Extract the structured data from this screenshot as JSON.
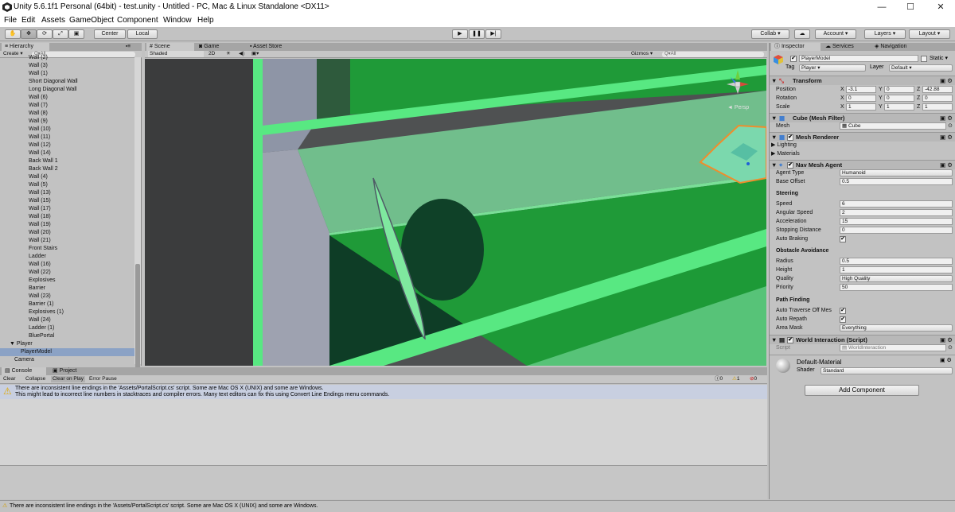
{
  "window": {
    "title": "Unity 5.6.1f1 Personal (64bit) - test.unity - Untitled - PC, Mac & Linux Standalone <DX11>",
    "minimize": "—",
    "maximize": "☐",
    "close": "✕"
  },
  "menu": [
    "File",
    "Edit",
    "Assets",
    "GameObject",
    "Component",
    "Window",
    "Help"
  ],
  "toolbar": {
    "center_label": "Center",
    "local_label": "Local",
    "collab_label": "Collab ▾",
    "account_label": "Account",
    "layers_label": "Layers",
    "layout_label": "Layout"
  },
  "hierarchy": {
    "tab_label": "Hierarchy",
    "create_label": "Create ▾",
    "search_placeholder": "Q▾All",
    "items": [
      {
        "label": "Wall (2)"
      },
      {
        "label": "Wall (3)"
      },
      {
        "label": "Wall (1)"
      },
      {
        "label": "Short Diagonal Wall"
      },
      {
        "label": "Long Diagonal Wall"
      },
      {
        "label": "Wall (6)"
      },
      {
        "label": "Wall (7)"
      },
      {
        "label": "Wall (8)"
      },
      {
        "label": "Wall (9)"
      },
      {
        "label": "Wall (10)"
      },
      {
        "label": "Wall (11)"
      },
      {
        "label": "Wall (12)"
      },
      {
        "label": "Wall (14)"
      },
      {
        "label": "Back Wall 1"
      },
      {
        "label": "Back Wall 2"
      },
      {
        "label": "Wall (4)"
      },
      {
        "label": "Wall (5)"
      },
      {
        "label": "Wall (13)"
      },
      {
        "label": "Wall (15)"
      },
      {
        "label": "Wall (17)"
      },
      {
        "label": "Wall (18)"
      },
      {
        "label": "Wall (19)"
      },
      {
        "label": "Wall (20)"
      },
      {
        "label": "Wall (21)"
      },
      {
        "label": "Front Stairs"
      },
      {
        "label": "Ladder"
      },
      {
        "label": "Wall (16)"
      },
      {
        "label": "Wall (22)"
      },
      {
        "label": "Explosives"
      },
      {
        "label": "Barrier"
      },
      {
        "label": "Wall (23)"
      },
      {
        "label": "Barrier (1)"
      },
      {
        "label": "Explosives (1)"
      },
      {
        "label": "Wall (24)"
      },
      {
        "label": "Ladder (1)"
      },
      {
        "label": "BluePortal"
      }
    ],
    "player_label": "▼ Player",
    "player_model_label": "PlayerModel",
    "camera_label": "Camera"
  },
  "scene": {
    "tabs": [
      "Scene",
      "Game",
      "Asset Store"
    ],
    "shading": "Shaded",
    "mode_2d": "2D",
    "gizmos_label": "Gizmos ▾",
    "search_placeholder": "Q▾All",
    "persp_label": "◄ Persp"
  },
  "console": {
    "tabs": [
      "Console",
      "Project"
    ],
    "buttons": [
      "Clear",
      "Collapse",
      "Clear on Play",
      "Error Pause"
    ],
    "counts": [
      "0",
      "1",
      "0"
    ],
    "message_line1": "There are inconsistent line endings in the 'Assets/PortalScript.cs' script. Some are Mac OS X (UNIX) and some are Windows.",
    "message_line2": "This might lead to incorrect line numbers in stacktraces and compiler errors. Many text editors can fix this using Convert Line Endings menu commands."
  },
  "inspector": {
    "tabs": [
      "Inspector",
      "Services",
      "Navigation"
    ],
    "object_name": "PlayerModel",
    "static_label": "Static ▾",
    "tag_label": "Tag",
    "tag_value": "Player",
    "layer_label": "Layer",
    "layer_value": "Default",
    "transform": {
      "title": "Transform",
      "position_label": "Position",
      "rotation_label": "Rotation",
      "scale_label": "Scale",
      "position": [
        "-3.1",
        "0",
        "-42.88"
      ],
      "rotation": [
        "0",
        "0",
        "0"
      ],
      "scale": [
        "1",
        "1",
        "1"
      ]
    },
    "mesh_filter": {
      "title": "Cube (Mesh Filter)",
      "mesh_label": "Mesh",
      "mesh_value": "Cube"
    },
    "mesh_renderer": {
      "title": "Mesh Renderer",
      "lighting": "Lighting",
      "materials": "Materials"
    },
    "nav_mesh_agent": {
      "title": "Nav Mesh Agent",
      "agent_type_label": "Agent Type",
      "agent_type": "Humanoid",
      "base_offset_label": "Base Offset",
      "base_offset": "0.5",
      "steering_title": "Steering",
      "speed_label": "Speed",
      "speed": "6",
      "angular_speed_label": "Angular Speed",
      "angular_speed": "2",
      "acceleration_label": "Acceleration",
      "acceleration": "15",
      "stopping_distance_label": "Stopping Distance",
      "stopping_distance": "0",
      "auto_braking_label": "Auto Braking",
      "obstacle_title": "Obstacle Avoidance",
      "radius_label": "Radius",
      "radius": "0.5",
      "height_label": "Height",
      "height": "1",
      "quality_label": "Quality",
      "quality": "High Quality",
      "priority_label": "Priority",
      "priority": "50",
      "path_title": "Path Finding",
      "auto_traverse_label": "Auto Traverse Off Mes",
      "auto_repath_label": "Auto Repath",
      "area_mask_label": "Area Mask",
      "area_mask": "Everything"
    },
    "world_interaction": {
      "title": "World Interaction (Script)",
      "script_label": "Script",
      "script_value": "WorldInteraction"
    },
    "material": {
      "name": "Default-Material",
      "shader_label": "Shader",
      "shader_value": "Standard"
    },
    "add_component": "Add Component"
  },
  "status_bar": {
    "message": "There are inconsistent line endings in the 'Assets/PortalScript.cs' script. Some are Mac OS X (UNIX) and some are Windows."
  }
}
